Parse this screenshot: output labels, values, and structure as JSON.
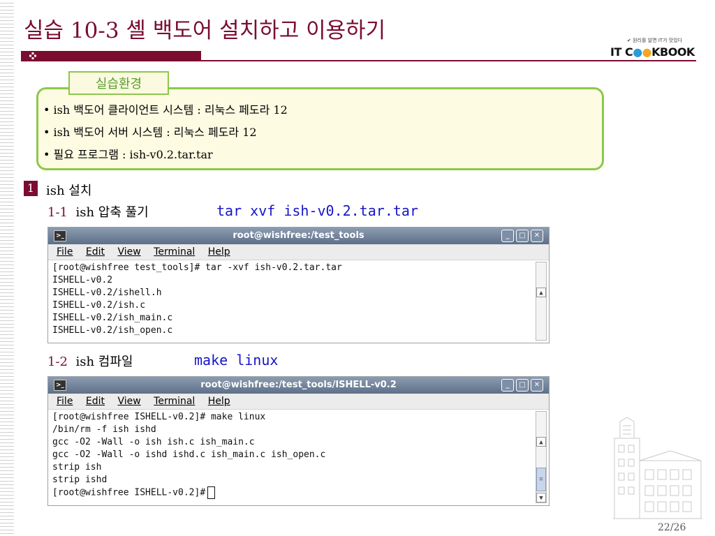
{
  "slide": {
    "title": "실습 10-3 셸 백도어 설치하고 이용하기",
    "logo_tagline": "원리를 알면 IT가 맛있다",
    "logo": {
      "part1": "IT C",
      "part2": "KBOOK"
    },
    "page": "22/26"
  },
  "environment": {
    "tab_label": "실습환경",
    "items": [
      "ish 백도어 클라이언트 시스템 : 리눅스 페도라 12",
      "ish 백도어 서버 시스템 : 리눅스 페도라 12",
      "필요 프로그램 : ish-v0.2.tar.tar"
    ]
  },
  "section": {
    "number": "1",
    "title": "ish 설치"
  },
  "step1": {
    "number": "1-1",
    "label": "ish 압축 풀기",
    "command": "tar xvf ish-v0.2.tar.tar"
  },
  "step2": {
    "number": "1-2",
    "label": "ish 컴파일",
    "command": "make linux"
  },
  "terminal1": {
    "title": "root@wishfree:/test_tools",
    "menu": [
      "File",
      "Edit",
      "View",
      "Terminal",
      "Help"
    ],
    "lines": [
      "[root@wishfree test_tools]# tar -xvf ish-v0.2.tar.tar",
      "ISHELL-v0.2",
      "ISHELL-v0.2/ishell.h",
      "ISHELL-v0.2/ish.c",
      "ISHELL-v0.2/ish_main.c",
      "ISHELL-v0.2/ish_open.c"
    ]
  },
  "terminal2": {
    "title": "root@wishfree:/test_tools/ISHELL-v0.2",
    "menu": [
      "File",
      "Edit",
      "View",
      "Terminal",
      "Help"
    ],
    "lines": [
      "[root@wishfree ISHELL-v0.2]# make linux",
      "/bin/rm -f ish ishd",
      "gcc -O2 -Wall -o ish ish.c ish_main.c",
      "gcc -O2 -Wall -o ishd ishd.c ish_main.c ish_open.c",
      "strip ish",
      "strip ishd"
    ],
    "prompt": "[root@wishfree ISHELL-v0.2]#"
  },
  "colors": {
    "accent": "#7a0d30",
    "env_border": "#8cc84b",
    "command": "#1515c8"
  }
}
